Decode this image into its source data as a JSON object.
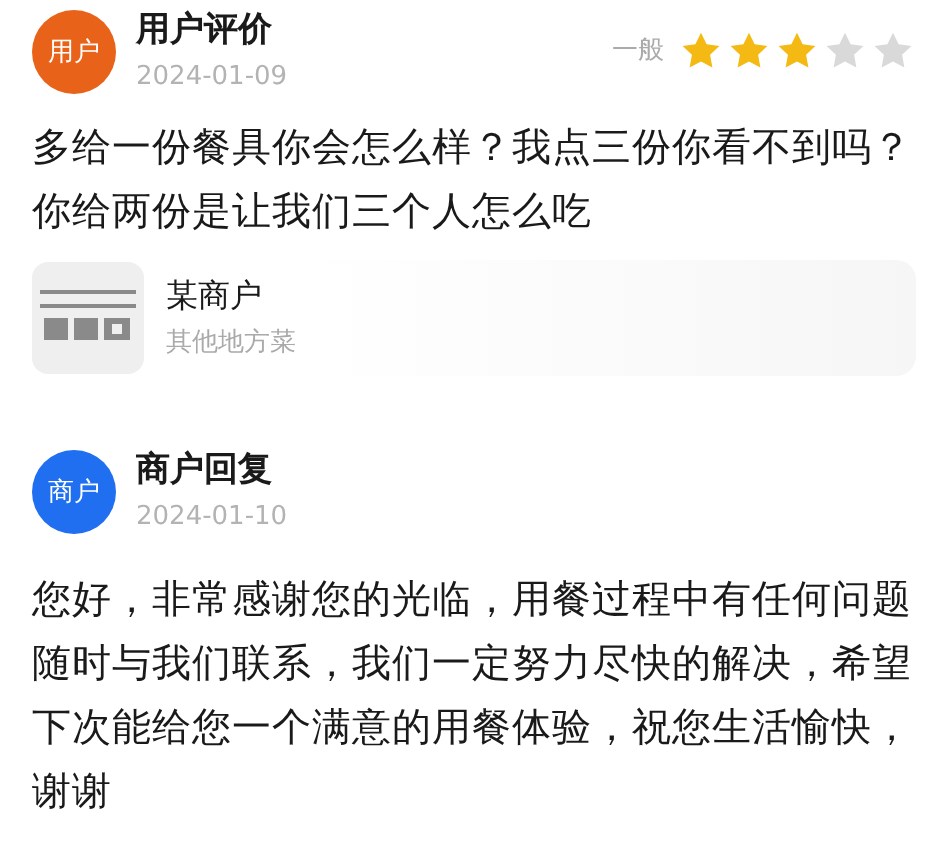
{
  "review": {
    "avatar": "用户",
    "author": "用户评价",
    "date": "2024-01-09",
    "rating_label": "一般",
    "stars": 3,
    "text": "多给一份餐具你会怎么样？我点三份你看不到吗？你给两份是让我们三个人怎么吃"
  },
  "shop": {
    "name": "某商户",
    "category": "其他地方菜"
  },
  "reply": {
    "avatar": "商户",
    "author": "商户回复",
    "date": "2024-01-10",
    "text": "您好，非常感谢您的光临，用餐过程中有任何问题随时与我们联系，我们一定努力尽快的解决，希望下次能给您一个满意的用餐体验，祝您生活愉快，谢谢"
  }
}
